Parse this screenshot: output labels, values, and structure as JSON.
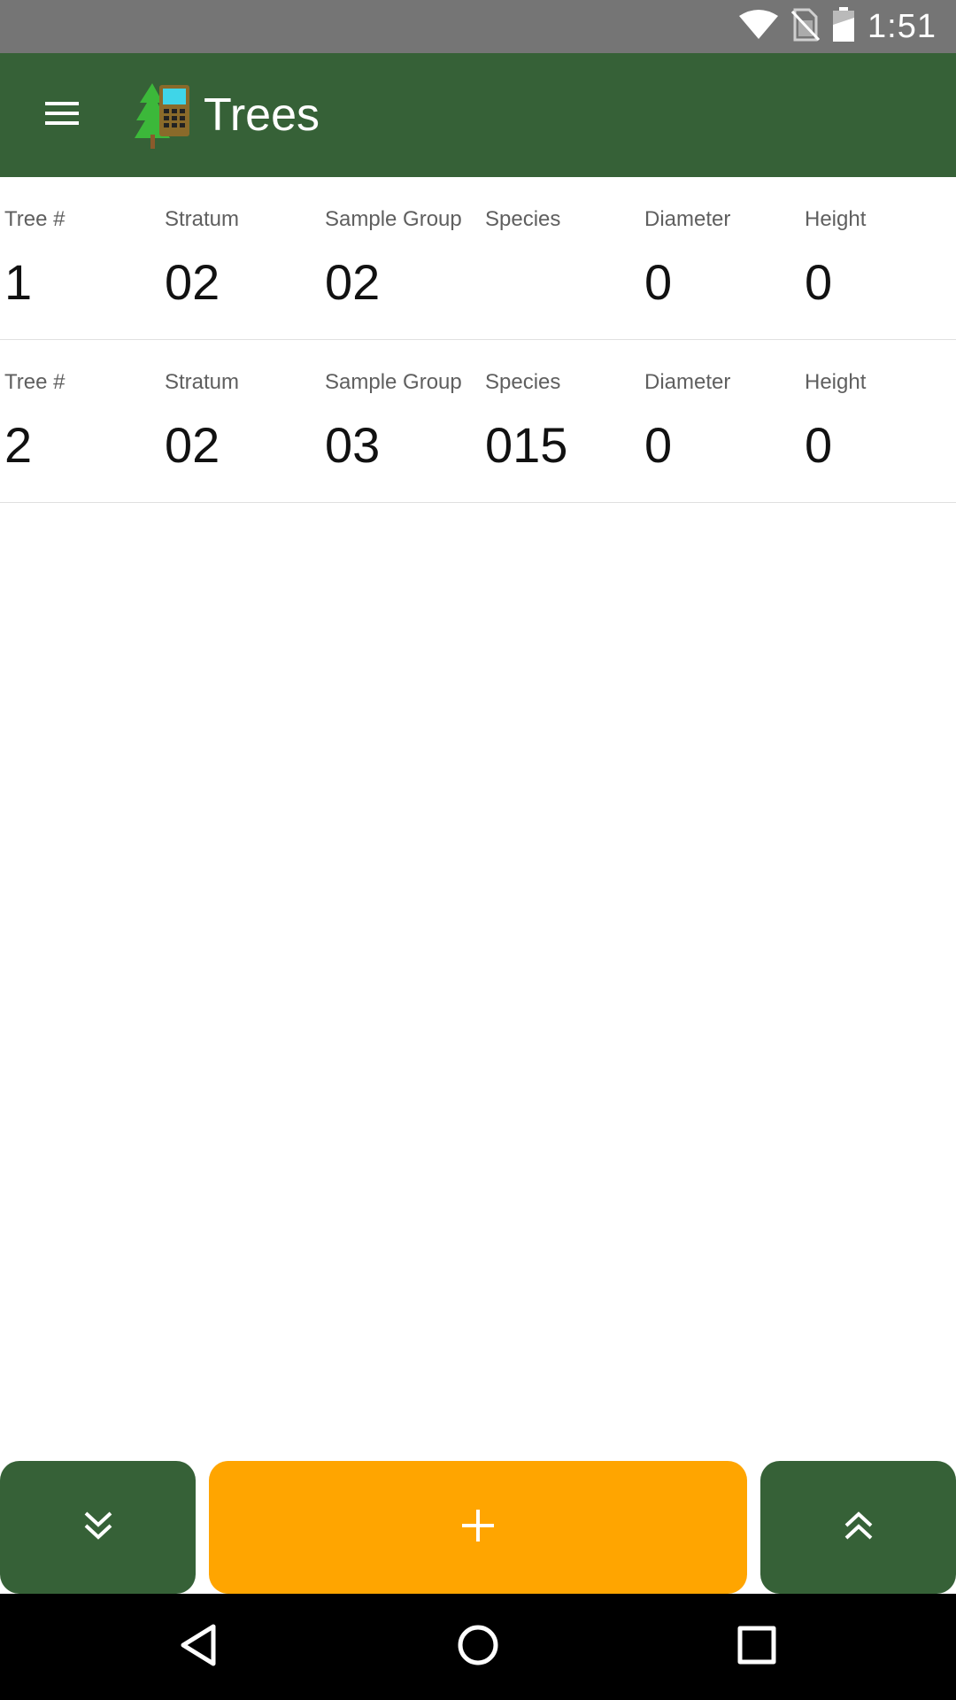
{
  "status_bar": {
    "time": "1:51",
    "icons": [
      "wifi-icon",
      "no-sim-icon",
      "battery-charging-icon"
    ]
  },
  "app_bar": {
    "title": "Trees",
    "menu_icon": "menu-icon",
    "logo_icon": "tree-device-logo",
    "color": "#366137"
  },
  "columns": [
    "Tree #",
    "Stratum",
    "Sample Group",
    "Species",
    "Diameter",
    "Height"
  ],
  "trees": [
    {
      "tree_num": "1",
      "stratum": "02",
      "sample_group": "02",
      "species": "",
      "diameter": "0",
      "height": "0"
    },
    {
      "tree_num": "2",
      "stratum": "02",
      "sample_group": "03",
      "species": "015",
      "diameter": "0",
      "height": "0"
    }
  ],
  "buttons": {
    "down_icon": "double-chevron-down-icon",
    "add_icon": "plus-icon",
    "up_icon": "double-chevron-up-icon",
    "add_color": "#ffa500",
    "nav_color": "#366137"
  },
  "nav_bar": {
    "icons": [
      "back-icon",
      "home-icon",
      "recents-icon"
    ]
  }
}
